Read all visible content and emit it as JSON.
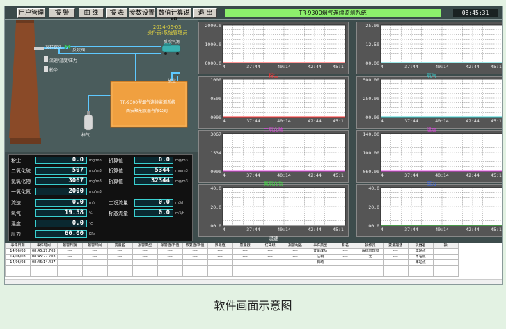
{
  "menu": {
    "items": [
      "用户管理",
      "报 警",
      "曲 线",
      "报 表",
      "参数设置",
      "数值计算说明",
      "退 出"
    ]
  },
  "header": {
    "title": "TR-9300烟气连续监测系统",
    "clock": "08:45:31"
  },
  "diagram": {
    "date": "2014-06-03",
    "status": "操作员:系统管理员",
    "labels": {
      "sampling_probe": "采样探头",
      "blowback_valve": "反吹阀",
      "blowback_source": "反吹气源",
      "flow_temp_pressure": "流速/温度/压力",
      "dust": "粉尘",
      "vent": "放空",
      "standard_gas": "标气",
      "cabinet_line1": "TR-9300型烟气连续监测系统",
      "cabinet_line2": "西安聚能仪器有限公司"
    }
  },
  "readings": [
    {
      "label": "粉尘",
      "value": "0.0",
      "unit": "mg/m3",
      "conv_label": "折算值",
      "conv_value": "0.0",
      "conv_unit": "mg/m3"
    },
    {
      "label": "二氧化硫",
      "value": "507",
      "unit": "mg/m3",
      "conv_label": "折算值",
      "conv_value": "5344",
      "conv_unit": "mg/m3"
    },
    {
      "label": "氮氧化物",
      "value": "3067",
      "unit": "mg/m3",
      "conv_label": "折算值",
      "conv_value": "32344",
      "conv_unit": "mg/m3"
    },
    {
      "label": "一氧化氮",
      "value": "2000",
      "unit": "mg/m3"
    },
    {
      "label": "流速",
      "value": "0.0",
      "unit": "m/s",
      "conv_label": "工况流量",
      "conv_value": "0.0",
      "conv_unit": "m3/h"
    },
    {
      "label": "氧气",
      "value": "19.58",
      "unit": "%",
      "conv_label": "标态流量",
      "conv_value": "0.0",
      "conv_unit": "m3/h"
    },
    {
      "label": "温度",
      "value": "0.0",
      "unit": "℃"
    },
    {
      "label": "压力",
      "value": "60.00",
      "unit": "KPa"
    }
  ],
  "chart_data": [
    {
      "type": "line",
      "title": "粉尘",
      "title_color": "#ff3030",
      "yticks": [
        "2000.0",
        "1000.0",
        "0000.0"
      ],
      "xticks": [
        "4",
        "37:44",
        "40:14",
        "42:44",
        "45:1"
      ],
      "ylim": [
        0,
        2000
      ],
      "series": [
        {
          "values": [
            0,
            0,
            0,
            0,
            0
          ]
        }
      ]
    },
    {
      "type": "line",
      "title": "氧气",
      "title_color": "#3cd0d0",
      "yticks": [
        "25.00",
        "12.50",
        "00.00"
      ],
      "xticks": [
        "4",
        "37:44",
        "40:14",
        "42:44",
        "45:1"
      ],
      "ylim": [
        0,
        25
      ],
      "series": [
        {
          "values": [
            0,
            0,
            0,
            0,
            0
          ]
        }
      ]
    },
    {
      "type": "line",
      "title": "",
      "title_color": "#ff3030",
      "yticks": [
        "1000",
        "0500",
        "0000"
      ],
      "xticks": [
        "4",
        "37:44",
        "40:14",
        "42:44",
        "45:1"
      ],
      "ylim": [
        0,
        1000
      ],
      "series": [
        {
          "values": [
            0,
            0,
            0,
            0,
            0
          ]
        }
      ]
    },
    {
      "type": "line",
      "title": "",
      "title_color": "#3cd0d0",
      "yticks": [
        "500.00",
        "250.00",
        "00.00"
      ],
      "xticks": [
        "4",
        "37:44",
        "40:14",
        "42:44",
        "45:1"
      ],
      "ylim": [
        0,
        500
      ],
      "series": [
        {
          "values": [
            0,
            0,
            0,
            0,
            0
          ]
        }
      ]
    },
    {
      "type": "line",
      "title": "二氧化硫",
      "title_color": "#e040e0",
      "yticks": [
        "3067",
        "1534",
        "0000"
      ],
      "xticks": [
        "4",
        "37:44",
        "40:14",
        "42:44",
        "45:1"
      ],
      "ylim": [
        0,
        3067
      ],
      "series": [
        {
          "values": [
            0,
            0,
            0,
            0,
            0
          ]
        }
      ]
    },
    {
      "type": "line",
      "title": "温度",
      "title_color": "#e040e0",
      "yticks": [
        "140.00",
        "100.00",
        "060.00"
      ],
      "xticks": [
        "4",
        "37:44",
        "40:14",
        "42:44",
        "45:1"
      ],
      "ylim": [
        60,
        140
      ],
      "series": [
        {
          "values": [
            0,
            0,
            0,
            0,
            0
          ]
        }
      ]
    },
    {
      "type": "line",
      "title": "氮氧化物",
      "title_color": "#40e040",
      "yticks": [
        "40.0",
        "20.0",
        "00.0"
      ],
      "xticks": [
        "4",
        "37:44",
        "40:14",
        "42:44",
        "45:1"
      ],
      "ylim": [
        0,
        40
      ],
      "series": [
        {
          "values": [
            0,
            0,
            0,
            0,
            0
          ]
        }
      ]
    },
    {
      "type": "line",
      "title": "压力",
      "title_color": "#3060f0",
      "yticks": [
        "",
        "",
        ""
      ],
      "xticks": [],
      "ylim": [
        0,
        1
      ],
      "series": [
        {
          "values": []
        }
      ]
    },
    {
      "type": "line",
      "title": "流速",
      "title_color": "#f0f0f0",
      "yticks": [
        "40.0",
        "20.0",
        "00.0"
      ],
      "xticks": [
        "4",
        "37:44",
        "40:14",
        "42:44",
        "45:1"
      ],
      "ylim": [
        0,
        40
      ],
      "series": [
        {
          "values": [
            0,
            0,
            0,
            0,
            0
          ]
        }
      ]
    }
  ],
  "events": {
    "headers": [
      "事件日期",
      "事件时间",
      "报警日期",
      "报警时间",
      "变量名",
      "报警类型",
      "报警值/旧值",
      "恢复值/新值",
      "界限值",
      "质量戳",
      "优先级",
      "报警组名",
      "事件类型",
      "机名",
      "操作员",
      "变量描述",
      "机器名",
      "操"
    ],
    "rows": [
      [
        "14/06/03",
        "08:45:27.703",
        "----",
        "----",
        "----",
        "----",
        "----",
        "----",
        "----",
        "----",
        "----",
        "----",
        "登录成功",
        "----",
        "系统管理员",
        "----",
        "本站点",
        ""
      ],
      [
        "14/06/03",
        "08:45:27.703",
        "----",
        "----",
        "----",
        "----",
        "----",
        "----",
        "----",
        "----",
        "----",
        "----",
        "注销",
        "----",
        "无",
        "----",
        "本站点",
        ""
      ],
      [
        "14/06/03",
        "08:45:14.437",
        "----",
        "----",
        "----",
        "----",
        "----",
        "----",
        "----",
        "----",
        "----",
        "----",
        "启动",
        "----",
        "----",
        "----",
        "本站点",
        ""
      ]
    ]
  },
  "caption": "软件画面示意图"
}
